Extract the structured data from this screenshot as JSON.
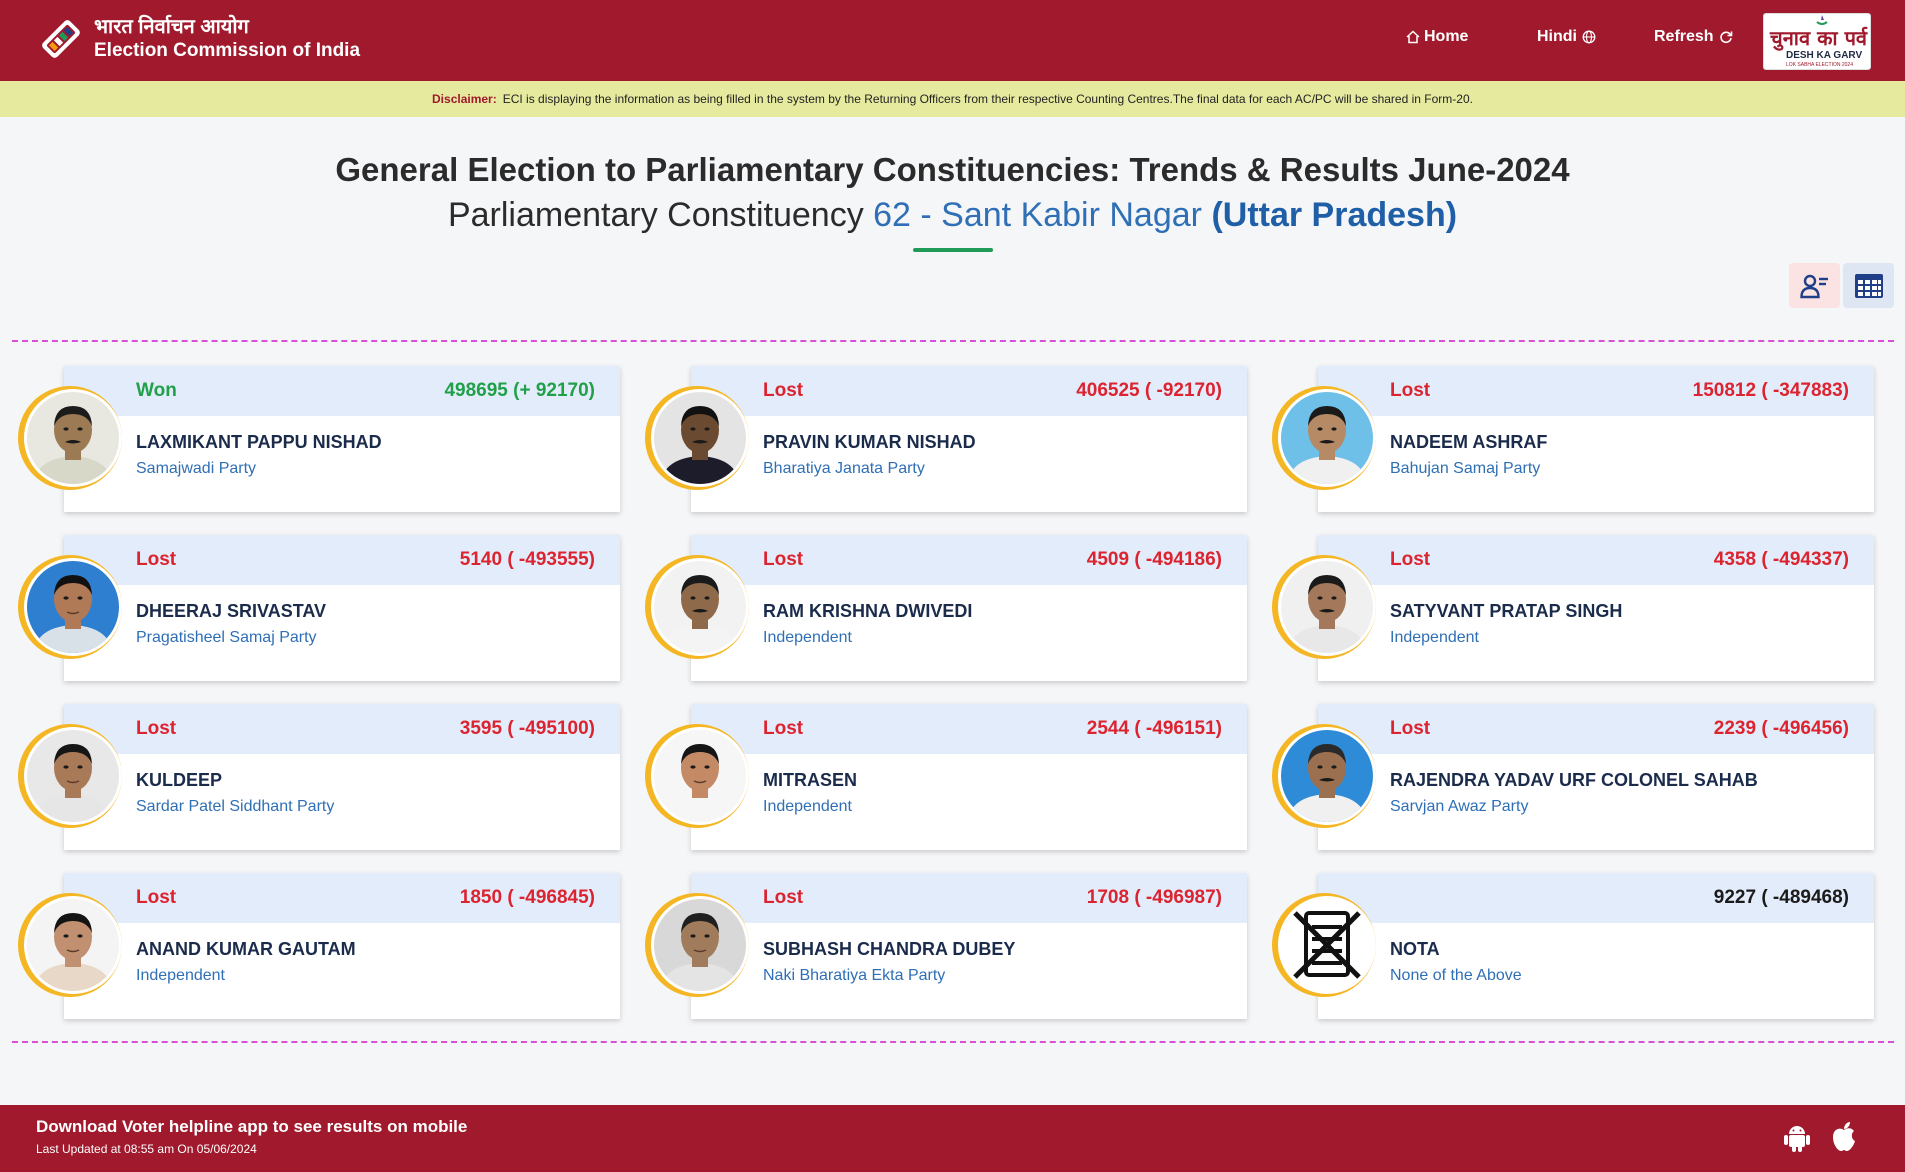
{
  "header": {
    "org_hindi": "भारत निर्वाचन आयोग",
    "org_english": "Election Commission of India",
    "nav_home": "Home",
    "nav_hindi": "Hindi",
    "nav_refresh": "Refresh",
    "badge_hindi": "चुनाव का पर्व",
    "badge_english": "DESH KA GARV",
    "badge_sub": "LOK SABHA ELECTION 2024"
  },
  "disclaimer": {
    "label": "Disclaimer:",
    "text": "ECI is displaying the information as being filled in the system by the Returning Officers from their respective Counting Centres.The final data for each AC/PC will be shared in Form-20."
  },
  "title": {
    "line1": "General Election to Parliamentary Constituencies: Trends & Results June-2024",
    "line2_prefix": "Parliamentary Constituency ",
    "constituency": "62 - Sant Kabir Nagar",
    "state": "(Uttar Pradesh)"
  },
  "candidates": [
    {
      "status": "Won",
      "votes": "498695 (+ 92170)",
      "name": "LAXMIKANT PAPPU NISHAD",
      "party": "Samajwadi Party",
      "photo": {
        "skin": "#9b7a54",
        "shirt": "#d8d8c8",
        "bg": "#e8e8e0",
        "hair": "#1c1c1c",
        "mustache": true
      }
    },
    {
      "status": "Lost",
      "votes": "406525 ( -92170)",
      "name": "PRAVIN KUMAR NISHAD",
      "party": "Bharatiya Janata Party",
      "photo": {
        "skin": "#6b4a32",
        "shirt": "#1c1c2a",
        "bg": "#e4e4e4",
        "hair": "#111111",
        "mustache": true
      }
    },
    {
      "status": "Lost",
      "votes": "150812 ( -347883)",
      "name": "NADEEM ASHRAF",
      "party": "Bahujan Samaj Party",
      "photo": {
        "skin": "#b58a64",
        "shirt": "#f0f0f0",
        "bg": "#6ec0e8",
        "hair": "#1a1a1a",
        "mustache": true
      }
    },
    {
      "status": "Lost",
      "votes": "5140 ( -493555)",
      "name": "DHEERAJ SRIVASTAV",
      "party": "Pragatisheel Samaj Party",
      "photo": {
        "skin": "#b07a56",
        "shirt": "#d8e0e8",
        "bg": "#2e7fd0",
        "hair": "#111111",
        "mustache": false
      }
    },
    {
      "status": "Lost",
      "votes": "4509 ( -494186)",
      "name": "RAM KRISHNA DWIVEDI",
      "party": "Independent",
      "photo": {
        "skin": "#8e6a4a",
        "shirt": "#f4f4f4",
        "bg": "#f2f2f2",
        "hair": "#1a1a1a",
        "mustache": true
      }
    },
    {
      "status": "Lost",
      "votes": "4358 ( -494337)",
      "name": "SATYVANT PRATAP SINGH",
      "party": "Independent",
      "photo": {
        "skin": "#a4785a",
        "shirt": "#e8e8e8",
        "bg": "#f0f0f0",
        "hair": "#1a1a1a",
        "mustache": true
      }
    },
    {
      "status": "Lost",
      "votes": "3595 ( -495100)",
      "name": "KULDEEP",
      "party": "Sardar Patel Siddhant Party",
      "photo": {
        "skin": "#a87a58",
        "shirt": "#e6e6e6",
        "bg": "#e8e8e8",
        "hair": "#161616",
        "mustache": false
      }
    },
    {
      "status": "Lost",
      "votes": "2544 ( -496151)",
      "name": "MITRASEN",
      "party": "Independent",
      "photo": {
        "skin": "#c48a66",
        "shirt": "#f6f6f6",
        "bg": "#f6f6f6",
        "hair": "#151515",
        "mustache": false
      }
    },
    {
      "status": "Lost",
      "votes": "2239 ( -496456)",
      "name": "RAJENDRA YADAV URF COLONEL SAHAB",
      "party": "Sarvjan Awaz Party",
      "photo": {
        "skin": "#9a7050",
        "shirt": "#f0f0f0",
        "bg": "#2e8bd8",
        "hair": "#2a2a2a",
        "mustache": true
      }
    },
    {
      "status": "Lost",
      "votes": "1850 ( -496845)",
      "name": "ANAND KUMAR GAUTAM",
      "party": "Independent",
      "photo": {
        "skin": "#c09070",
        "shirt": "#e8d8c8",
        "bg": "#f4f4f4",
        "hair": "#141414",
        "mustache": false
      }
    },
    {
      "status": "Lost",
      "votes": "1708 ( -496987)",
      "name": "SUBHASH CHANDRA DUBEY",
      "party": "Naki Bharatiya Ekta Party",
      "photo": {
        "skin": "#a07c5c",
        "shirt": "#e4e4e4",
        "bg": "#d8d8d8",
        "hair": "#202020",
        "mustache": false
      }
    },
    {
      "status": "",
      "votes": "9227 ( -489468)",
      "name": "NOTA",
      "party": "None of the Above",
      "photo": null
    }
  ],
  "footer": {
    "line1": "Download Voter helpline app to see results on mobile",
    "line2": "Last Updated at 08:55 am On 05/06/2024"
  },
  "colors": {
    "brand": "#a0192c",
    "won": "#21a04a",
    "lost": "#dc2430",
    "link": "#2f6fb5",
    "ring": "#f4b623"
  }
}
